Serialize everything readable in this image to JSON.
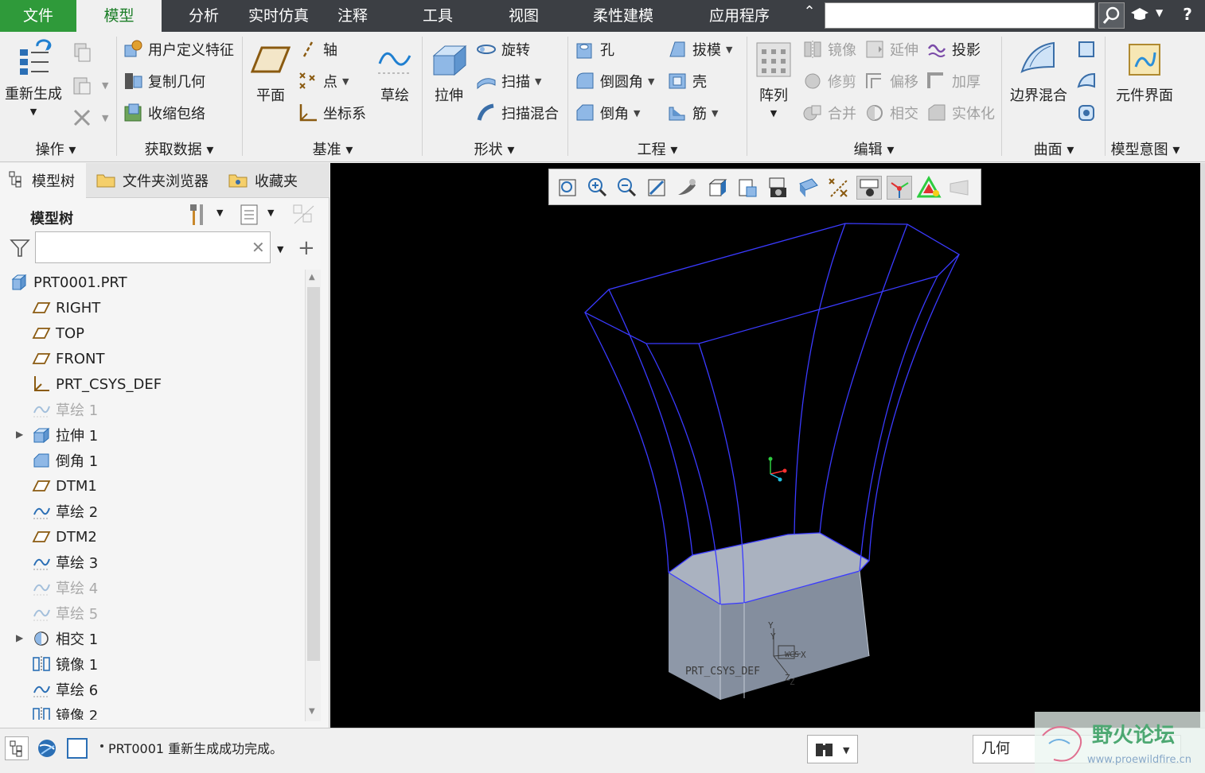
{
  "menubar": {
    "tabs": [
      "文件",
      "模型",
      "分析",
      "实时仿真",
      "注释",
      "工具",
      "视图",
      "柔性建模",
      "应用程序"
    ],
    "search_placeholder": "",
    "help_label": "?"
  },
  "ribbon": {
    "operations": {
      "label": "操作",
      "regenerate": "重新生成"
    },
    "get_data": {
      "label": "获取数据",
      "udf": "用户定义特征",
      "copy_geom": "复制几何",
      "shrinkwrap": "收缩包络"
    },
    "datum": {
      "label": "基准",
      "plane": "平面",
      "axis": "轴",
      "point": "点",
      "csys": "坐标系",
      "sketch": "草绘"
    },
    "shapes": {
      "label": "形状",
      "extrude": "拉伸",
      "revolve": "旋转",
      "sweep": "扫描",
      "swept_blend": "扫描混合"
    },
    "engineering": {
      "label": "工程",
      "hole": "孔",
      "round": "倒圆角",
      "chamfer": "倒角",
      "draft": "拔模",
      "shell": "壳",
      "rib": "筋"
    },
    "editing": {
      "label": "编辑",
      "pattern": "阵列",
      "mirror": "镜像",
      "extend": "延伸",
      "project": "投影",
      "trim": "修剪",
      "offset": "偏移",
      "thicken": "加厚",
      "merge": "合并",
      "intersect": "相交",
      "solidify": "实体化"
    },
    "surfaces": {
      "label": "曲面",
      "boundary_blend": "边界混合"
    },
    "model_intent": {
      "label": "模型意图",
      "component_interface": "元件界面"
    }
  },
  "navigator": {
    "tabs": [
      "模型树",
      "文件夹浏览器",
      "收藏夹"
    ],
    "tree_title": "模型树",
    "filter_placeholder": "",
    "items": [
      {
        "label": "PRT0001.PRT",
        "icon": "part-icon",
        "dim": false,
        "expand": false
      },
      {
        "label": "RIGHT",
        "icon": "datum-plane-icon",
        "dim": false,
        "expand": false
      },
      {
        "label": "TOP",
        "icon": "datum-plane-icon",
        "dim": false,
        "expand": false
      },
      {
        "label": "FRONT",
        "icon": "datum-plane-icon",
        "dim": false,
        "expand": false
      },
      {
        "label": "PRT_CSYS_DEF",
        "icon": "csys-icon",
        "dim": false,
        "expand": false
      },
      {
        "label": "草绘 1",
        "icon": "sketch-icon",
        "dim": true,
        "expand": false
      },
      {
        "label": "拉伸 1",
        "icon": "extrude-icon",
        "dim": false,
        "expand": true
      },
      {
        "label": "倒角 1",
        "icon": "chamfer-icon",
        "dim": false,
        "expand": false
      },
      {
        "label": "DTM1",
        "icon": "datum-plane-icon",
        "dim": false,
        "expand": false
      },
      {
        "label": "草绘 2",
        "icon": "sketch-icon",
        "dim": false,
        "expand": false
      },
      {
        "label": "DTM2",
        "icon": "datum-plane-icon",
        "dim": false,
        "expand": false
      },
      {
        "label": "草绘 3",
        "icon": "sketch-icon",
        "dim": false,
        "expand": false
      },
      {
        "label": "草绘 4",
        "icon": "sketch-icon",
        "dim": true,
        "expand": false
      },
      {
        "label": "草绘 5",
        "icon": "sketch-icon",
        "dim": true,
        "expand": false
      },
      {
        "label": "相交 1",
        "icon": "intersect-icon",
        "dim": false,
        "expand": true
      },
      {
        "label": "镜像 1",
        "icon": "mirror-icon",
        "dim": false,
        "expand": false
      },
      {
        "label": "草绘 6",
        "icon": "sketch-icon",
        "dim": false,
        "expand": false
      },
      {
        "label": "镜像 2",
        "icon": "mirror-icon",
        "dim": false,
        "expand": false
      }
    ]
  },
  "graphics": {
    "csys_label": "PRT_CSYS_DEF",
    "axis_y": "Y",
    "axis_x": "X",
    "axis_z": "Z",
    "wcs_label": "WCS"
  },
  "statusbar": {
    "message": "PRT0001 重新生成成功完成。",
    "filter_value": "几何"
  },
  "watermark": {
    "title": "野火论坛",
    "url": "www.proewildfire.cn"
  },
  "colors": {
    "file_tab": "#2f9a3a",
    "model_tab_text": "#1a7d26",
    "menubar": "#3c3f44",
    "wire": "#3a3aff",
    "solid_face": "#9aa4b3"
  }
}
